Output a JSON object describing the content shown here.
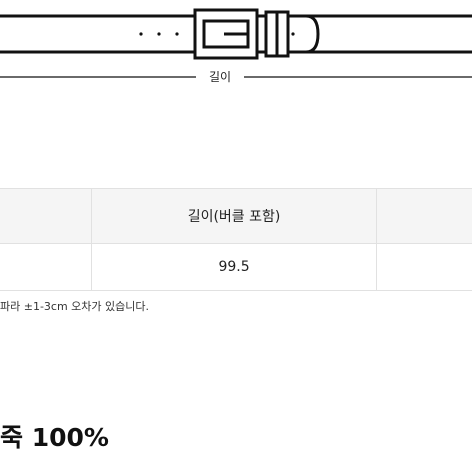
{
  "belt_diagram": {
    "length_label": "길이"
  },
  "size_table": {
    "header": [
      "",
      "길이(버클 포함)",
      ""
    ],
    "rows": [
      [
        "",
        "99.5",
        ""
      ]
    ]
  },
  "note": "파라 ±1-3cm 오차가 있습니다.",
  "material": "죽 100%"
}
